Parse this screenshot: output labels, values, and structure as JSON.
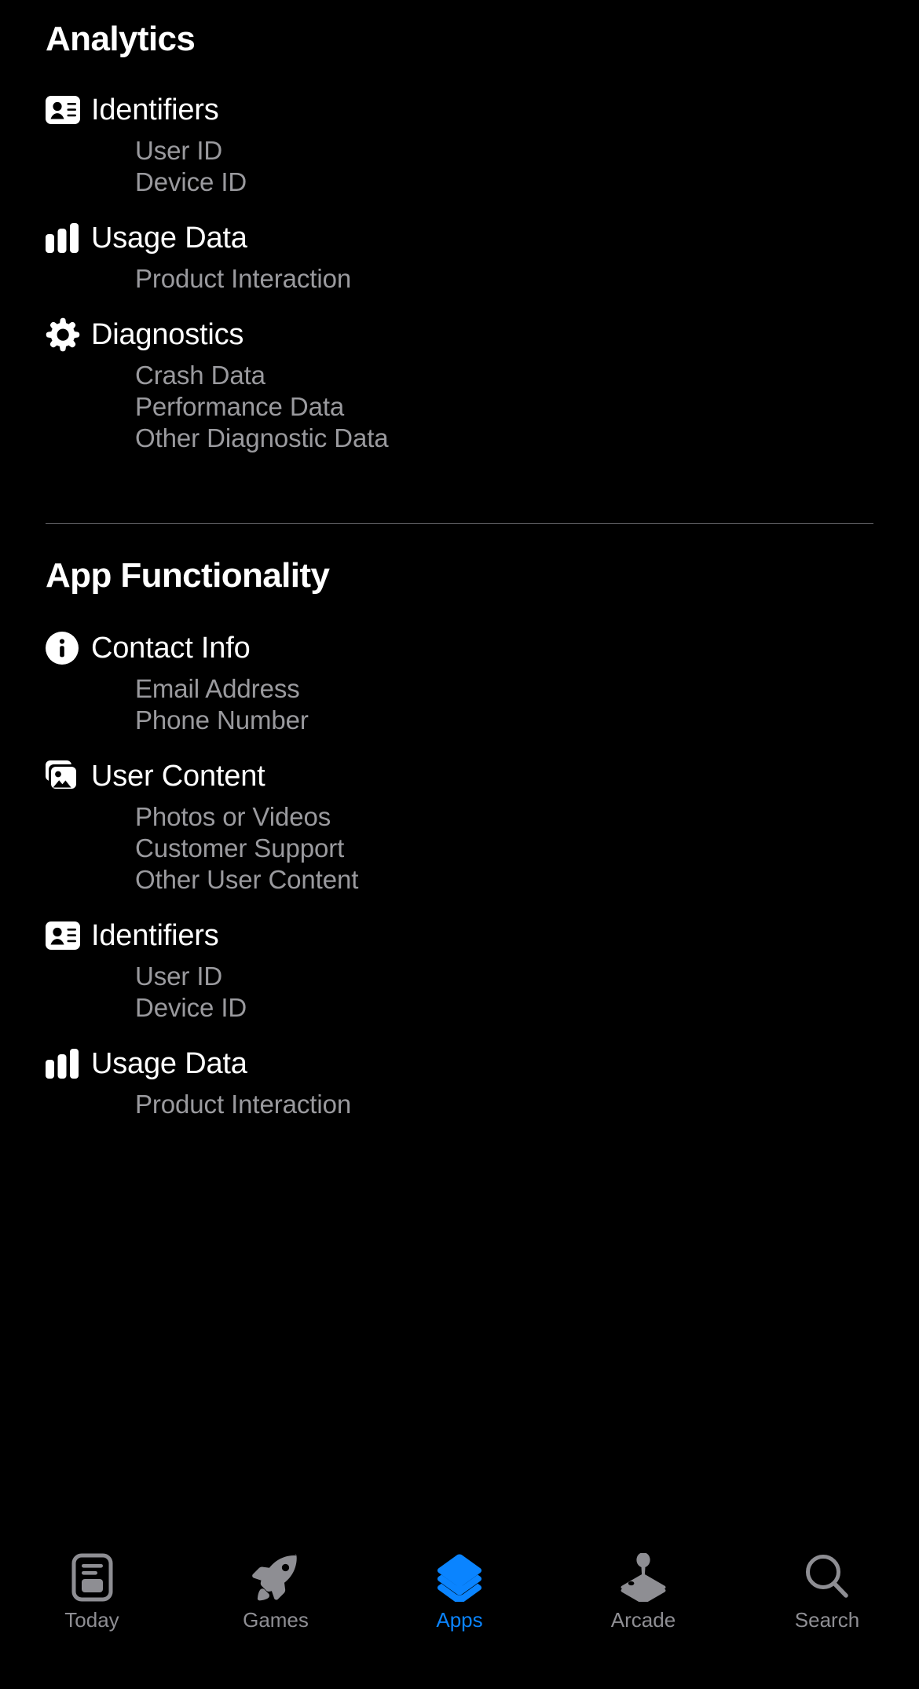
{
  "accent_color": "#0a84ff",
  "inactive_color": "#8e8e93",
  "subitem_color": "#9a9a9e",
  "background_color": "#000000",
  "sections": [
    {
      "title": "Analytics",
      "categories": [
        {
          "icon": "contact-card-icon",
          "label": "Identifiers",
          "items": [
            "User ID",
            "Device ID"
          ]
        },
        {
          "icon": "bar-chart-icon",
          "label": "Usage Data",
          "items": [
            "Product Interaction"
          ]
        },
        {
          "icon": "gear-icon",
          "label": "Diagnostics",
          "items": [
            "Crash Data",
            "Performance Data",
            "Other Diagnostic Data"
          ]
        }
      ]
    },
    {
      "title": "App Functionality",
      "categories": [
        {
          "icon": "info-circle-icon",
          "label": "Contact Info",
          "items": [
            "Email Address",
            "Phone Number"
          ]
        },
        {
          "icon": "photo-stack-icon",
          "label": "User Content",
          "items": [
            "Photos or Videos",
            "Customer Support",
            "Other User Content"
          ]
        },
        {
          "icon": "contact-card-icon",
          "label": "Identifiers",
          "items": [
            "User ID",
            "Device ID"
          ]
        },
        {
          "icon": "bar-chart-icon",
          "label": "Usage Data",
          "items": [
            "Product Interaction"
          ]
        }
      ]
    }
  ],
  "tabbar": {
    "tabs": [
      {
        "label": "Today",
        "icon": "today-card-icon",
        "active": false
      },
      {
        "label": "Games",
        "icon": "rocket-icon",
        "active": false
      },
      {
        "label": "Apps",
        "icon": "layers-stack-icon",
        "active": true
      },
      {
        "label": "Arcade",
        "icon": "joystick-icon",
        "active": false
      },
      {
        "label": "Search",
        "icon": "magnifier-icon",
        "active": false
      }
    ]
  }
}
